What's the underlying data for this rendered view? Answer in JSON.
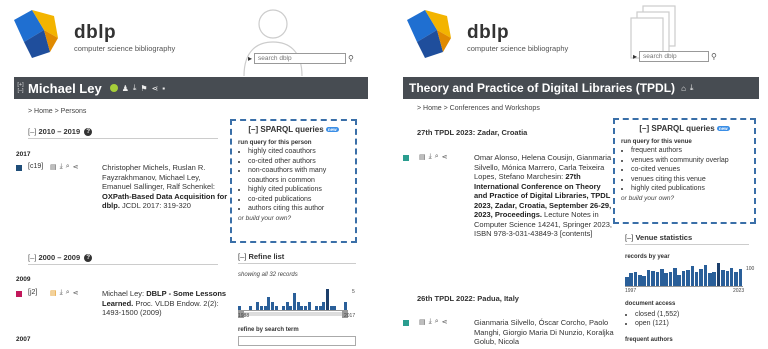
{
  "colors": {
    "titlebar": "#474c52",
    "sparql_border": "#3a6fa8",
    "bar": "#2a5f99",
    "bar_highlight": "#1d3f6b",
    "conf_marker": "#2a9d8f",
    "journal_marker": "#c2185b",
    "blue_marker": "#1f4e79"
  },
  "left": {
    "brand": "dblp",
    "tagline": "computer science bibliography",
    "search_placeholder": "search dblp",
    "title": "Michael Ley",
    "breadcrumb": "> Home > Persons",
    "sections": [
      {
        "toggle": "[–]",
        "label": "2010 – 2019"
      },
      {
        "toggle": "[–]",
        "label": "2000 – 2009"
      }
    ],
    "years": [
      "2017",
      "2009",
      "2007"
    ],
    "entries": [
      {
        "key": "[c19]",
        "authors": "Christopher Michels, Ruslan R. Fayzrakhmanov, Michael Ley, Emanuel Sallinger, Ralf Schenkel:",
        "title": "OXPath-Based Data Acquisition for dblp.",
        "venue": "JCDL 2017: 319-320"
      },
      {
        "key": "[j2]",
        "authors": "Michael Ley:",
        "title": "DBLP - Some Lessons Learned.",
        "venue": "Proc. VLDB Endow. 2(2): 1493-1500 (2009)"
      }
    ],
    "sparql": {
      "heading": "SPARQL queries",
      "new_badge": "new",
      "run_label": "run query for this person",
      "items": [
        "highly cited coauthors",
        "co-cited other authors",
        "non-coauthors with many coauthors in common",
        "highly cited publications",
        "co-cited publications",
        "authors citing this author"
      ],
      "own": "or build your own?"
    },
    "refine": {
      "heading": "Refine list",
      "showing": "showing all 32 records",
      "axis_start": "1988",
      "axis_end": "2017",
      "axis_max": "5",
      "refine_label": "refine by search term",
      "hist_values": [
        1,
        0,
        0,
        1,
        0,
        2,
        1,
        1,
        3,
        2,
        1,
        0,
        1,
        2,
        1,
        4,
        2,
        1,
        1,
        2,
        0,
        1,
        1,
        2,
        5,
        1,
        1,
        0,
        0,
        2
      ]
    }
  },
  "right": {
    "brand": "dblp",
    "tagline": "computer science bibliography",
    "search_placeholder": "search dblp",
    "title": "Theory and Practice of Digital Libraries (TPDL)",
    "breadcrumb": "> Home > Conferences and Workshops",
    "events": [
      {
        "heading": "27th TPDL 2023: Zadar, Croatia",
        "authors": "Omar Alonso, Helena Cousijn, Gianmaria Silvello, Mónica Marrero, Carla Teixeira Lopes, Stefano Marchesin:",
        "title": "27th International Conference on Theory and Practice of Digital Libraries, TPDL 2023, Zadar, Croatia, September 26-29, 2023, Proceedings.",
        "venue": "Lecture Notes in Computer Science 14241, Springer 2023, ISBN 978-3-031-43849-3",
        "contents": "[contents]"
      },
      {
        "heading": "26th TPDL 2022: Padua, Italy",
        "authors": "Gianmaria Silvello, Óscar Corcho, Paolo Manghi, Giorgio Maria Di Nunzio, Koraljka Golub, Nicola"
      }
    ],
    "sparql": {
      "heading": "SPARQL queries",
      "new_badge": "new",
      "run_label": "run query for this venue",
      "items": [
        "frequent authors",
        "venues with community overlap",
        "co-cited venues",
        "venues citing this venue",
        "highly cited publications"
      ],
      "own": "or build your own?"
    },
    "venue_stats": {
      "heading": "Venue statistics",
      "records_label": "records by year",
      "axis_start": "1997",
      "axis_end": "2023",
      "axis_max": "100",
      "hist_values": [
        40,
        55,
        60,
        50,
        45,
        70,
        65,
        60,
        75,
        55,
        60,
        80,
        50,
        65,
        70,
        85,
        60,
        75,
        90,
        55,
        60,
        100,
        70,
        65,
        80,
        60,
        75
      ],
      "doc_access_label": "document access",
      "access": [
        "closed (1,552)",
        "open (121)"
      ],
      "frequent_authors": "frequent authors"
    }
  }
}
